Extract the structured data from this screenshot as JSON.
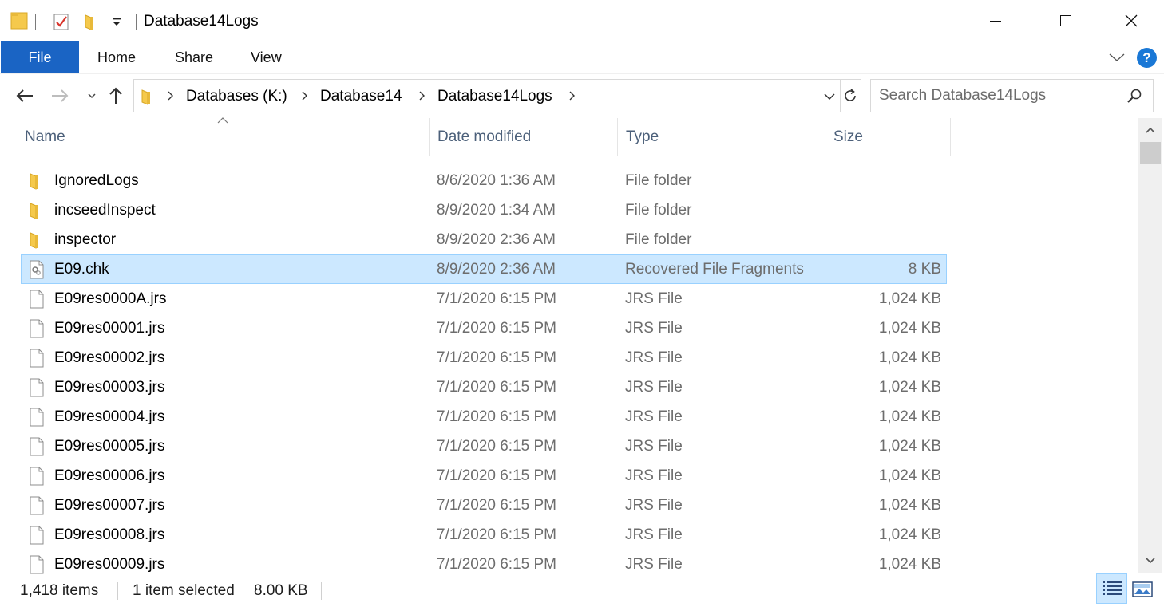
{
  "window": {
    "title": "Database14Logs"
  },
  "ribbon": {
    "tabs": [
      {
        "label": "File",
        "active": true
      },
      {
        "label": "Home"
      },
      {
        "label": "Share"
      },
      {
        "label": "View"
      }
    ],
    "help_label": "?"
  },
  "nav": {
    "breadcrumbs": [
      "Databases (K:)",
      "Database14",
      "Database14Logs"
    ],
    "search_placeholder": "Search Database14Logs"
  },
  "columns": {
    "name": "Name",
    "date": "Date modified",
    "type": "Type",
    "size": "Size"
  },
  "files": [
    {
      "name": "IgnoredLogs",
      "date": "8/6/2020 1:36 AM",
      "type": "File folder",
      "size": "",
      "icon": "folder-icon"
    },
    {
      "name": "incseedInspect",
      "date": "8/9/2020 1:34 AM",
      "type": "File folder",
      "size": "",
      "icon": "folder-icon"
    },
    {
      "name": "inspector",
      "date": "8/9/2020 2:36 AM",
      "type": "File folder",
      "size": "",
      "icon": "folder-icon"
    },
    {
      "name": "E09.chk",
      "date": "8/9/2020 2:36 AM",
      "type": "Recovered File Fragments",
      "size": "8 KB",
      "icon": "system-file-icon",
      "selected": true
    },
    {
      "name": "E09res0000A.jrs",
      "date": "7/1/2020 6:15 PM",
      "type": "JRS File",
      "size": "1,024 KB",
      "icon": "file-icon"
    },
    {
      "name": "E09res00001.jrs",
      "date": "7/1/2020 6:15 PM",
      "type": "JRS File",
      "size": "1,024 KB",
      "icon": "file-icon"
    },
    {
      "name": "E09res00002.jrs",
      "date": "7/1/2020 6:15 PM",
      "type": "JRS File",
      "size": "1,024 KB",
      "icon": "file-icon"
    },
    {
      "name": "E09res00003.jrs",
      "date": "7/1/2020 6:15 PM",
      "type": "JRS File",
      "size": "1,024 KB",
      "icon": "file-icon"
    },
    {
      "name": "E09res00004.jrs",
      "date": "7/1/2020 6:15 PM",
      "type": "JRS File",
      "size": "1,024 KB",
      "icon": "file-icon"
    },
    {
      "name": "E09res00005.jrs",
      "date": "7/1/2020 6:15 PM",
      "type": "JRS File",
      "size": "1,024 KB",
      "icon": "file-icon"
    },
    {
      "name": "E09res00006.jrs",
      "date": "7/1/2020 6:15 PM",
      "type": "JRS File",
      "size": "1,024 KB",
      "icon": "file-icon"
    },
    {
      "name": "E09res00007.jrs",
      "date": "7/1/2020 6:15 PM",
      "type": "JRS File",
      "size": "1,024 KB",
      "icon": "file-icon"
    },
    {
      "name": "E09res00008.jrs",
      "date": "7/1/2020 6:15 PM",
      "type": "JRS File",
      "size": "1,024 KB",
      "icon": "file-icon"
    },
    {
      "name": "E09res00009.jrs",
      "date": "7/1/2020 6:15 PM",
      "type": "JRS File",
      "size": "1,024 KB",
      "icon": "file-icon"
    }
  ],
  "status": {
    "item_count": "1,418 items",
    "selected": "1 item selected",
    "selected_size": "8.00 KB"
  },
  "colors": {
    "accent": "#1a64c4",
    "selection": "#cce8ff",
    "selection_border": "#99d1ff",
    "folder": "#f5c94c"
  }
}
